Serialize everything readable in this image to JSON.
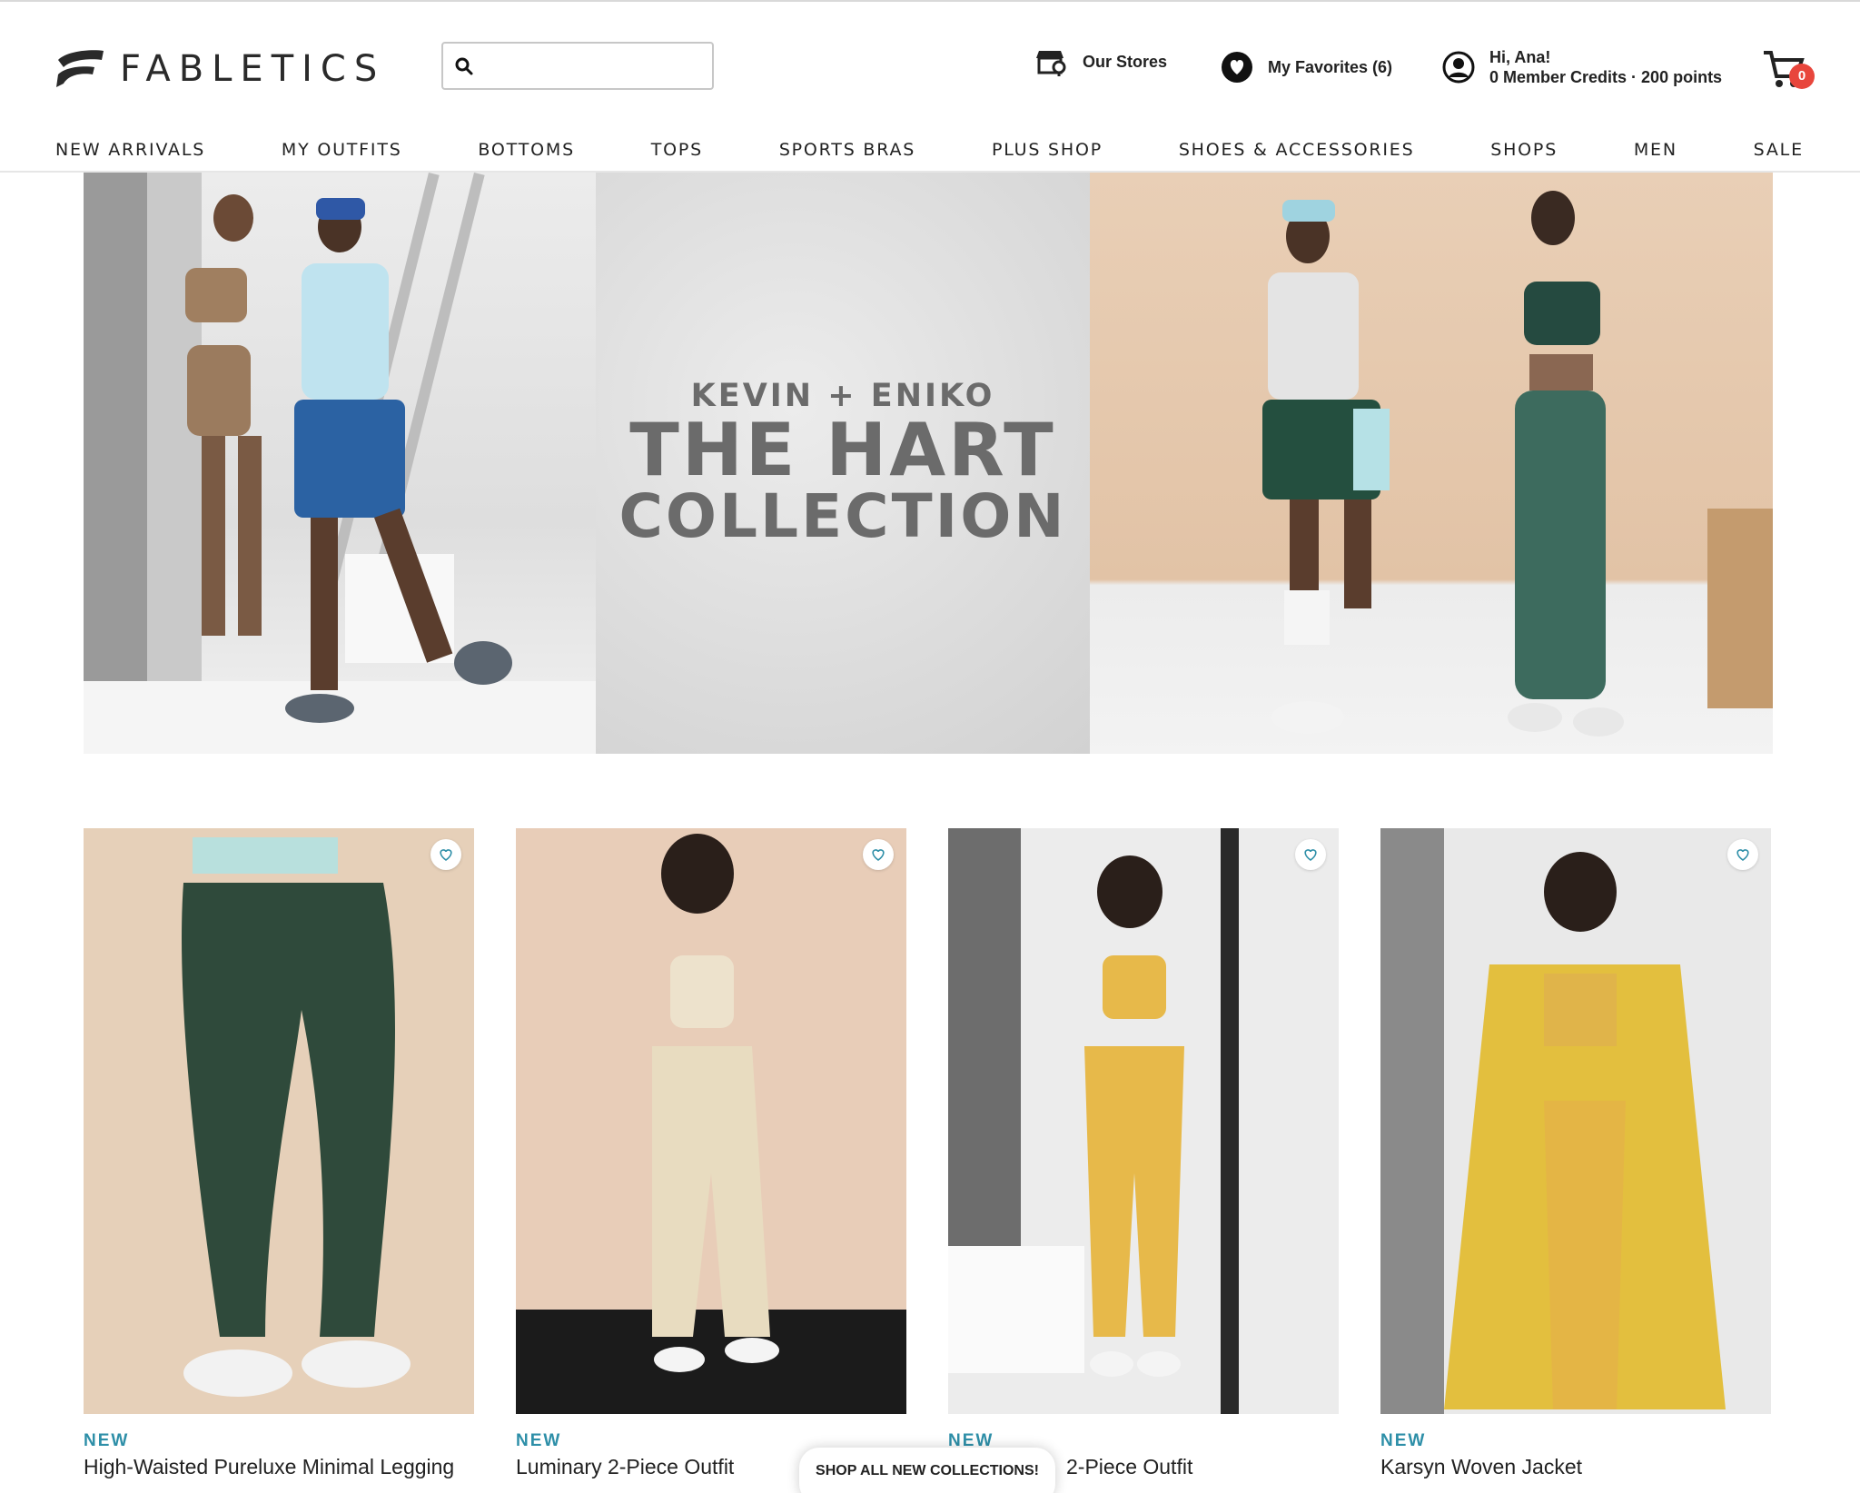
{
  "brand": {
    "name": "FABLETICS"
  },
  "search": {
    "placeholder": "",
    "value": ""
  },
  "utility": {
    "stores_label": "Our Stores",
    "favorites_label": "My Favorites (6)",
    "greeting": "Hi, Ana!",
    "credits": "0 Member Credits · 200 points",
    "cart_count": "0"
  },
  "nav": {
    "items": [
      "NEW ARRIVALS",
      "MY OUTFITS",
      "BOTTOMS",
      "TOPS",
      "SPORTS BRAS",
      "PLUS SHOP",
      "SHOES & ACCESSORIES",
      "SHOPS",
      "MEN",
      "SALE"
    ]
  },
  "hero": {
    "kicker": "KEVIN + ENIKO",
    "title": "THE HART",
    "subtitle": "COLLECTION"
  },
  "products": [
    {
      "tag": "NEW",
      "name": "High-Waisted Pureluxe Minimal Legging",
      "color": "#2f4a3b"
    },
    {
      "tag": "NEW",
      "name": "Luminary 2-Piece Outfit",
      "color": "#e8dcc0"
    },
    {
      "tag": "NEW",
      "name": "2-Piece Outfit",
      "color": "#e7b94a"
    },
    {
      "tag": "NEW",
      "name": "Karsyn Woven Jacket",
      "color": "#e3bf3e"
    }
  ],
  "floating": {
    "shop_all_label": "SHOP ALL NEW COLLECTIONS!"
  },
  "colors": {
    "accent_teal": "#2e8fa8",
    "price_orange": "#f08a4b",
    "badge_red": "#e8463c"
  }
}
